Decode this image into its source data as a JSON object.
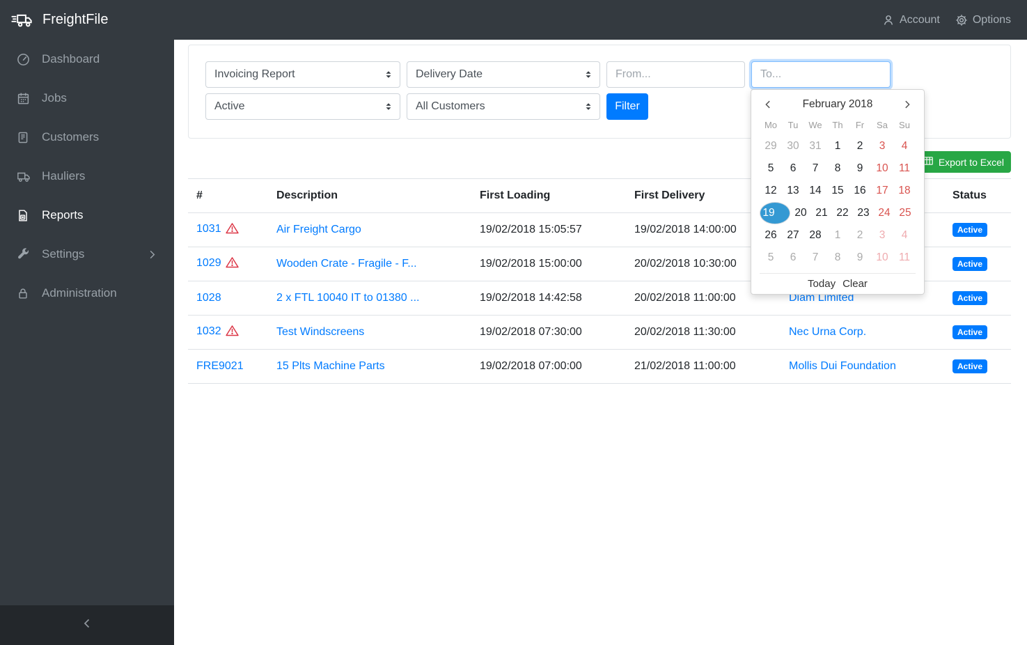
{
  "brand": {
    "name": "FreightFile"
  },
  "topbar": {
    "account": "Account",
    "options": "Options"
  },
  "sidebar": {
    "items": [
      {
        "label": "Dashboard",
        "icon": "gauge-icon",
        "active": false,
        "submenu": false
      },
      {
        "label": "Jobs",
        "icon": "calendar-icon",
        "active": false,
        "submenu": false
      },
      {
        "label": "Customers",
        "icon": "journal-icon",
        "active": false,
        "submenu": false
      },
      {
        "label": "Hauliers",
        "icon": "truck-icon",
        "active": false,
        "submenu": false
      },
      {
        "label": "Reports",
        "icon": "report-file-icon",
        "active": true,
        "submenu": false
      },
      {
        "label": "Settings",
        "icon": "tools-icon",
        "active": false,
        "submenu": true
      },
      {
        "label": "Administration",
        "icon": "lock-icon",
        "active": false,
        "submenu": false
      }
    ]
  },
  "filters": {
    "report_type": {
      "value": "Invoicing Report"
    },
    "date_field": {
      "value": "Delivery Date"
    },
    "from": {
      "placeholder": "From...",
      "value": ""
    },
    "to": {
      "placeholder": "To...",
      "value": ""
    },
    "status": {
      "value": "Active"
    },
    "customer": {
      "value": "All Customers"
    },
    "filter_label": "Filter"
  },
  "export_label": "Export to Excel",
  "table": {
    "headers": [
      "#",
      "Description",
      "First Loading",
      "First Delivery",
      "",
      "Status"
    ],
    "rows": [
      {
        "id": "1031",
        "warning": true,
        "description": "Air Freight Cargo",
        "first_loading": "19/02/2018 15:05:57",
        "first_delivery": "19/02/2018 14:00:00",
        "customer": "",
        "status": "Active"
      },
      {
        "id": "1029",
        "warning": true,
        "description": "Wooden Crate - Fragile - F...",
        "first_loading": "19/02/2018 15:00:00",
        "first_delivery": "20/02/2018 10:30:00",
        "customer": "",
        "status": "Active"
      },
      {
        "id": "1028",
        "warning": false,
        "description": "2 x FTL 10040 IT to 01380 ...",
        "first_loading": "19/02/2018 14:42:58",
        "first_delivery": "20/02/2018 11:00:00",
        "customer": "Diam Limited",
        "status": "Active"
      },
      {
        "id": "1032",
        "warning": true,
        "description": "Test Windscreens",
        "first_loading": "19/02/2018 07:30:00",
        "first_delivery": "20/02/2018 11:30:00",
        "customer": "Nec Urna Corp.",
        "status": "Active"
      },
      {
        "id": "FRE9021",
        "warning": false,
        "description": "15 Plts Machine Parts",
        "first_loading": "19/02/2018 07:00:00",
        "first_delivery": "21/02/2018 11:00:00",
        "customer": "Mollis Dui Foundation",
        "status": "Active"
      }
    ]
  },
  "datepicker": {
    "title": "February 2018",
    "day_names": [
      "Mo",
      "Tu",
      "We",
      "Th",
      "Fr",
      "Sa",
      "Su"
    ],
    "weeks": [
      [
        {
          "d": "29",
          "cls": "old"
        },
        {
          "d": "30",
          "cls": "old"
        },
        {
          "d": "31",
          "cls": "old"
        },
        {
          "d": "1",
          "cls": ""
        },
        {
          "d": "2",
          "cls": ""
        },
        {
          "d": "3",
          "cls": "we"
        },
        {
          "d": "4",
          "cls": "we"
        }
      ],
      [
        {
          "d": "5",
          "cls": ""
        },
        {
          "d": "6",
          "cls": ""
        },
        {
          "d": "7",
          "cls": ""
        },
        {
          "d": "8",
          "cls": ""
        },
        {
          "d": "9",
          "cls": ""
        },
        {
          "d": "10",
          "cls": "we"
        },
        {
          "d": "11",
          "cls": "we"
        }
      ],
      [
        {
          "d": "12",
          "cls": ""
        },
        {
          "d": "13",
          "cls": ""
        },
        {
          "d": "14",
          "cls": ""
        },
        {
          "d": "15",
          "cls": ""
        },
        {
          "d": "16",
          "cls": ""
        },
        {
          "d": "17",
          "cls": "we"
        },
        {
          "d": "18",
          "cls": "we"
        }
      ],
      [
        {
          "d": "19",
          "cls": "sel"
        },
        {
          "d": "20",
          "cls": ""
        },
        {
          "d": "21",
          "cls": ""
        },
        {
          "d": "22",
          "cls": ""
        },
        {
          "d": "23",
          "cls": ""
        },
        {
          "d": "24",
          "cls": "we"
        },
        {
          "d": "25",
          "cls": "we"
        }
      ],
      [
        {
          "d": "26",
          "cls": ""
        },
        {
          "d": "27",
          "cls": ""
        },
        {
          "d": "28",
          "cls": ""
        },
        {
          "d": "1",
          "cls": "new"
        },
        {
          "d": "2",
          "cls": "new"
        },
        {
          "d": "3",
          "cls": "new we"
        },
        {
          "d": "4",
          "cls": "new we"
        }
      ],
      [
        {
          "d": "5",
          "cls": "new"
        },
        {
          "d": "6",
          "cls": "new"
        },
        {
          "d": "7",
          "cls": "new"
        },
        {
          "d": "8",
          "cls": "new"
        },
        {
          "d": "9",
          "cls": "new"
        },
        {
          "d": "10",
          "cls": "new we"
        },
        {
          "d": "11",
          "cls": "new we"
        }
      ]
    ],
    "today_label": "Today",
    "clear_label": "Clear"
  },
  "colors": {
    "topbar_bg": "#343a40",
    "collapse_bg": "#23272b",
    "primary_blue": "#007bff",
    "export_green": "#28a745",
    "warning_red": "#dc3545",
    "weekend_red": "#d9534f",
    "selected_day_blue": "#3499d3",
    "border_gray": "#dee2e6"
  }
}
